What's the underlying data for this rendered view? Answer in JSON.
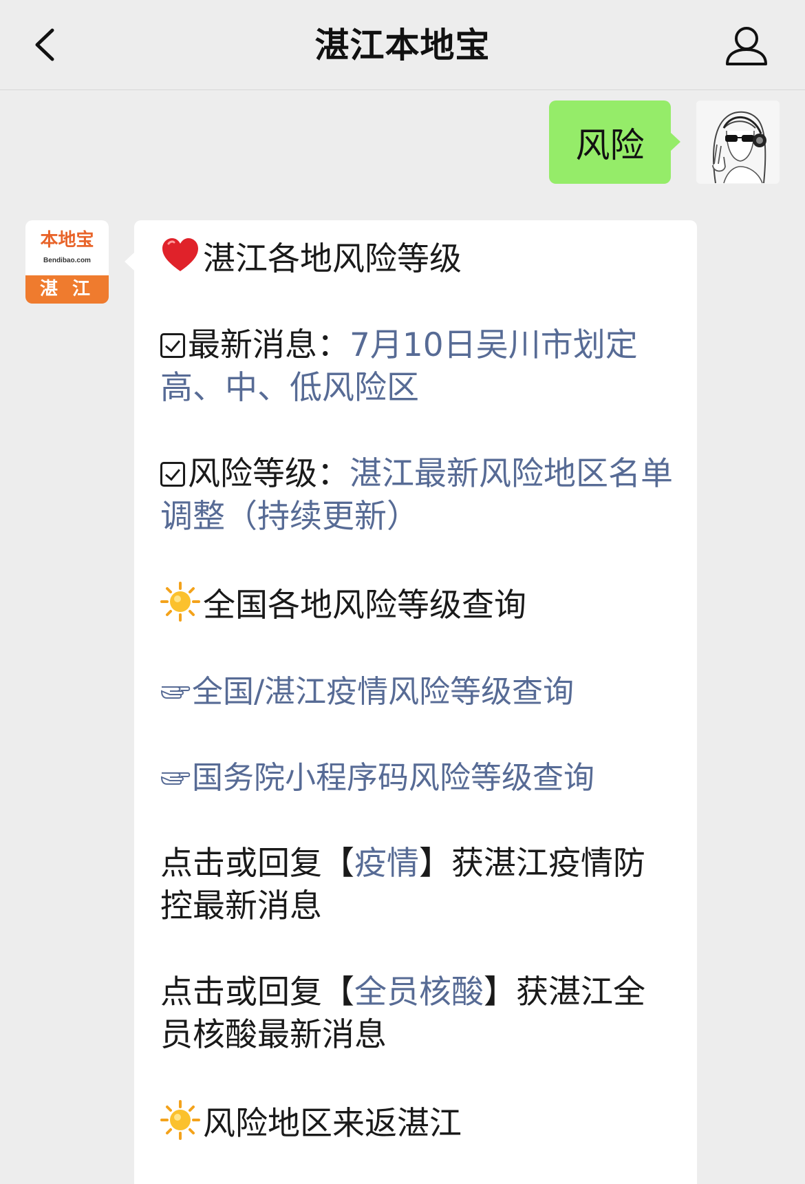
{
  "navbar": {
    "title": "湛江本地宝",
    "back_icon": "chevron-left-icon",
    "profile_icon": "person-icon"
  },
  "outgoing": {
    "text": "风险"
  },
  "bot": {
    "avatar": {
      "logo_text": "本地宝",
      "logo_url": "Bendibao.com",
      "city": "湛 江",
      "colors": {
        "orange": "#ef7b2e",
        "orange_text": "#e8642a"
      }
    }
  },
  "message": {
    "heading": {
      "icon": "heart-icon",
      "text": "湛江各地风险等级"
    },
    "latest": {
      "icon": "checkbox-icon",
      "label": "最新消息：",
      "link": "7月10日吴川市划定高、中、低风险区"
    },
    "level": {
      "icon": "checkbox-icon",
      "label": "风险等级：",
      "link": "湛江最新风险地区名单调整（持续更新）"
    },
    "national": {
      "icon": "sun-icon",
      "text": "全国各地风险等级查询"
    },
    "link1": {
      "icon": "pointing-hand-icon",
      "text": "全国/湛江疫情风险等级查询"
    },
    "link2": {
      "icon": "pointing-hand-icon",
      "text": "国务院小程序码风险等级查询"
    },
    "reply1": {
      "prefix": "点击或回复【",
      "keyword": "疫情",
      "suffix": "】获湛江疫情防控最新消息"
    },
    "reply2": {
      "prefix": "点击或回复【",
      "keyword": "全员核酸",
      "suffix": "】获湛江全员核酸最新消息"
    },
    "travel": {
      "icon": "sun-icon",
      "text": "风险地区来返湛江"
    }
  },
  "colors": {
    "background": "#ededed",
    "outgoing_bubble": "#95ec69",
    "incoming_bubble": "#ffffff",
    "link": "#576b95",
    "text": "#1a1a1a"
  }
}
